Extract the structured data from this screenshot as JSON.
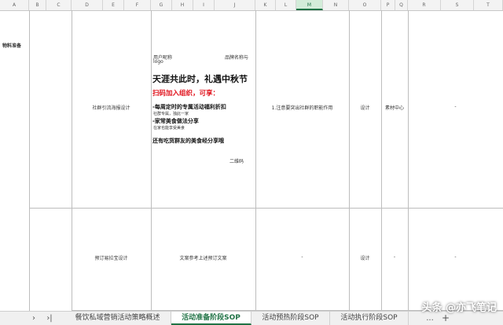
{
  "columns": [
    "A",
    "B",
    "C",
    "D",
    "E",
    "F",
    "G",
    "H",
    "I",
    "J",
    "K",
    "L",
    "M",
    "N",
    "O",
    "P",
    "Q",
    "R",
    "S",
    "T"
  ],
  "row1": {
    "stage": "物料准备",
    "type": "社群引流海报设计",
    "poster": {
      "avatar_label": "用户昵称",
      "brand_label": "品牌名称与",
      "logo_label": "logo",
      "headline": "天涯共此时，礼遇中秋节",
      "cta": "扫码加入组织，可享：",
      "benefit1": "-每周定时的专属活动福利折扣",
      "benefit1_sub": "社群专属，独此一家",
      "benefit2": "-家常美食做法分享",
      "benefit2_sub": "在家也能享受美食",
      "benefit3": "还有吃货群友的美食经分享哦",
      "qr_label": "二维码"
    },
    "notes": "1.注意要突出社群的职能作用",
    "owner": "设计",
    "source": "素材中心",
    "extra": "-"
  },
  "row2": {
    "type": "预订易拉宝设计",
    "content": "文案参考上述预订文案",
    "notes": "-",
    "owner": "设计",
    "source": "-",
    "extra": "-"
  },
  "tabs": {
    "nav_next": "›",
    "nav_last": "›|",
    "items": [
      "餐饮私域营销活动策略概述",
      "活动准备阶段SOP",
      "活动预热阶段SOP",
      "活动执行阶段SOP"
    ],
    "more": "...",
    "add": "+"
  },
  "watermark": "头条 @亦飞笔记",
  "colors": {
    "accent": "#217346",
    "red_text": "#e0101a"
  }
}
